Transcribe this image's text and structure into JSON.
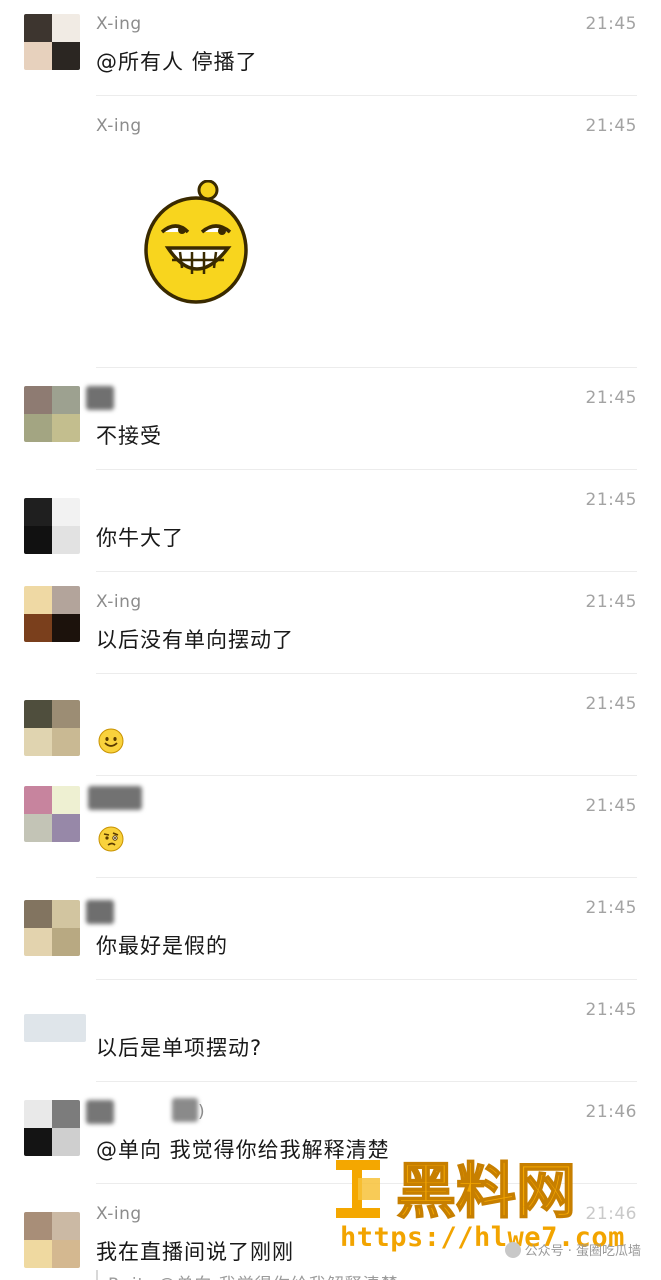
{
  "messages": [
    {
      "name": "X-ing",
      "time": "21:45",
      "text": "@所有人 停播了"
    },
    {
      "name": "X-ing",
      "time": "21:45",
      "sticker": "grinning-yellow-face-sticker"
    },
    {
      "name": "",
      "time": "21:45",
      "text": "不接受"
    },
    {
      "name": "",
      "time": "21:45",
      "text": "你牛大了"
    },
    {
      "name": "X-ing",
      "time": "21:45",
      "text": "以后没有单向摆动了"
    },
    {
      "name": "",
      "time": "21:45",
      "emoji": "smile-emoji"
    },
    {
      "name": "",
      "time": "21:45",
      "emoji": "doubt-emoji"
    },
    {
      "name": "",
      "time": "21:45",
      "text": "你最好是假的"
    },
    {
      "name": "",
      "time": "21:45",
      "text": "以后是单项摆动?"
    },
    {
      "name_suffix": ")",
      "time": "21:46",
      "text": "@单向 我觉得你给我解释清楚"
    },
    {
      "name": "X-ing",
      "time": "21:46",
      "text": "我在直播间说了刚刚",
      "quote": "Ruit: @单向 我觉得你给我解释清楚"
    }
  ],
  "watermark": {
    "logo_text": "黑料网",
    "url": "https://hlwe7.com",
    "public_account": "公众号 · 蛋圈吃瓜墙"
  },
  "colors": {
    "name_gray": "#8c8c8c",
    "time_gray": "#a3a3a3",
    "text": "#191919",
    "watermark_orange": "#f2a400"
  }
}
